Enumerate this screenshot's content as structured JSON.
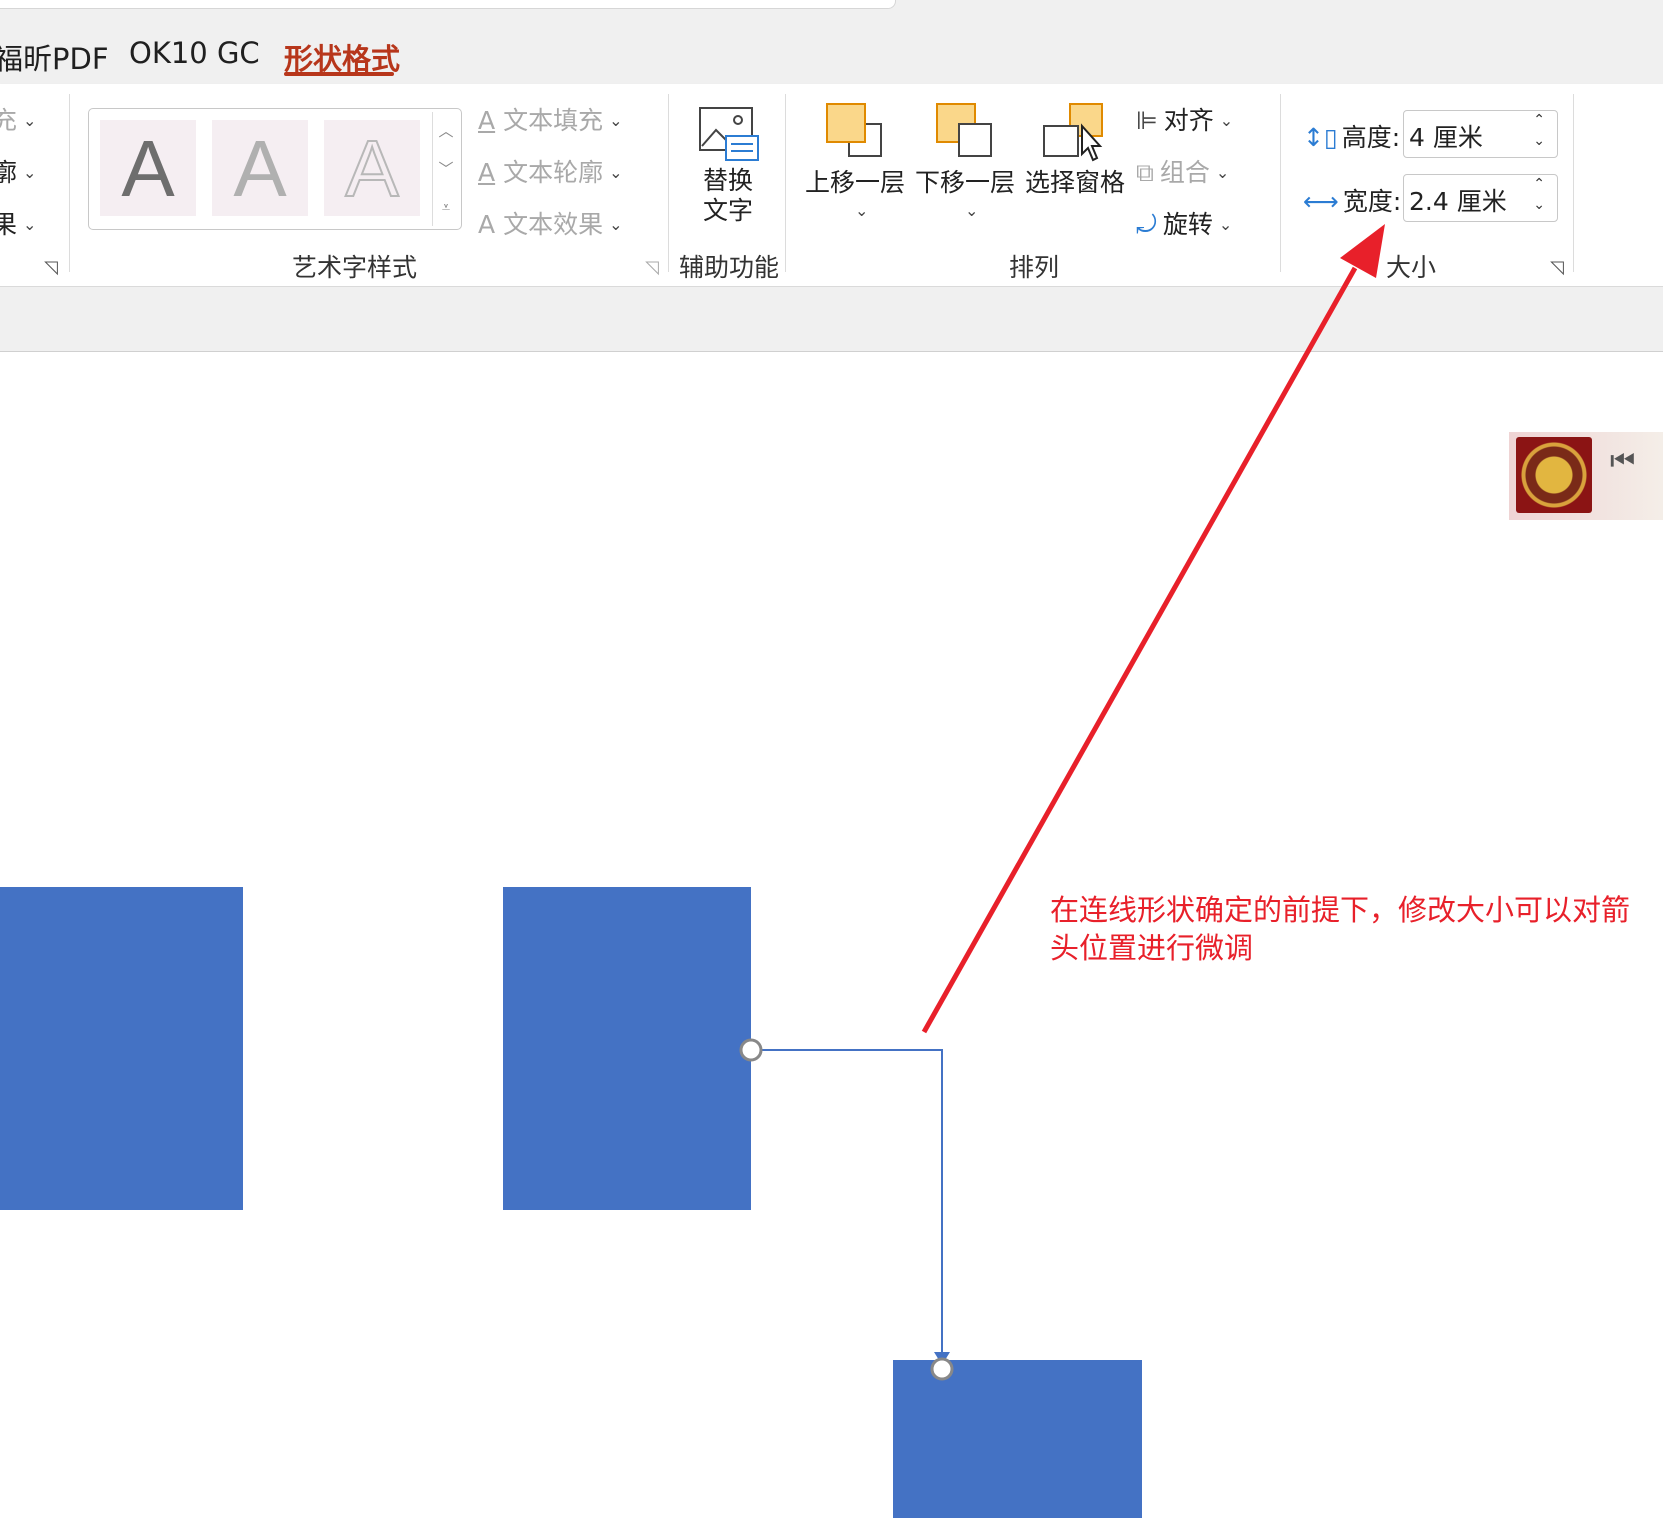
{
  "tabs": [
    {
      "label": "福昕PDF"
    },
    {
      "label": "OK10 GC"
    },
    {
      "label": "形状格式",
      "active": true
    }
  ],
  "shape_styles_partial": {
    "items": [
      {
        "label": "充"
      },
      {
        "label": "廓"
      },
      {
        "label": "果"
      }
    ]
  },
  "wordart": {
    "swatches": [
      "A",
      "A",
      "A"
    ],
    "text_fill": "文本填充",
    "text_outline": "文本轮廓",
    "text_effects": "文本效果",
    "group_label": "艺术字样式"
  },
  "accessibility": {
    "alt_text_line1": "替换",
    "alt_text_line2": "文字",
    "group_label": "辅助功能"
  },
  "arrange": {
    "bring_forward": "上移一层",
    "send_backward": "下移一层",
    "selection_pane": "选择窗格",
    "align": "对齐",
    "group": "组合",
    "rotate": "旋转",
    "group_label": "排列"
  },
  "size": {
    "height_label": "高度:",
    "height_value": "4 厘米",
    "width_label": "宽度:",
    "width_value": "2.4 厘米",
    "group_label": "大小"
  },
  "annotation": {
    "text": "在连线形状确定的前提下，修改大小可以对箭头位置进行微调",
    "color": "#e8202a"
  },
  "colors": {
    "accent": "#b7361b",
    "shape_fill": "#4472c4",
    "connector": "#4472c4",
    "icon_orange": "#fad78a"
  }
}
